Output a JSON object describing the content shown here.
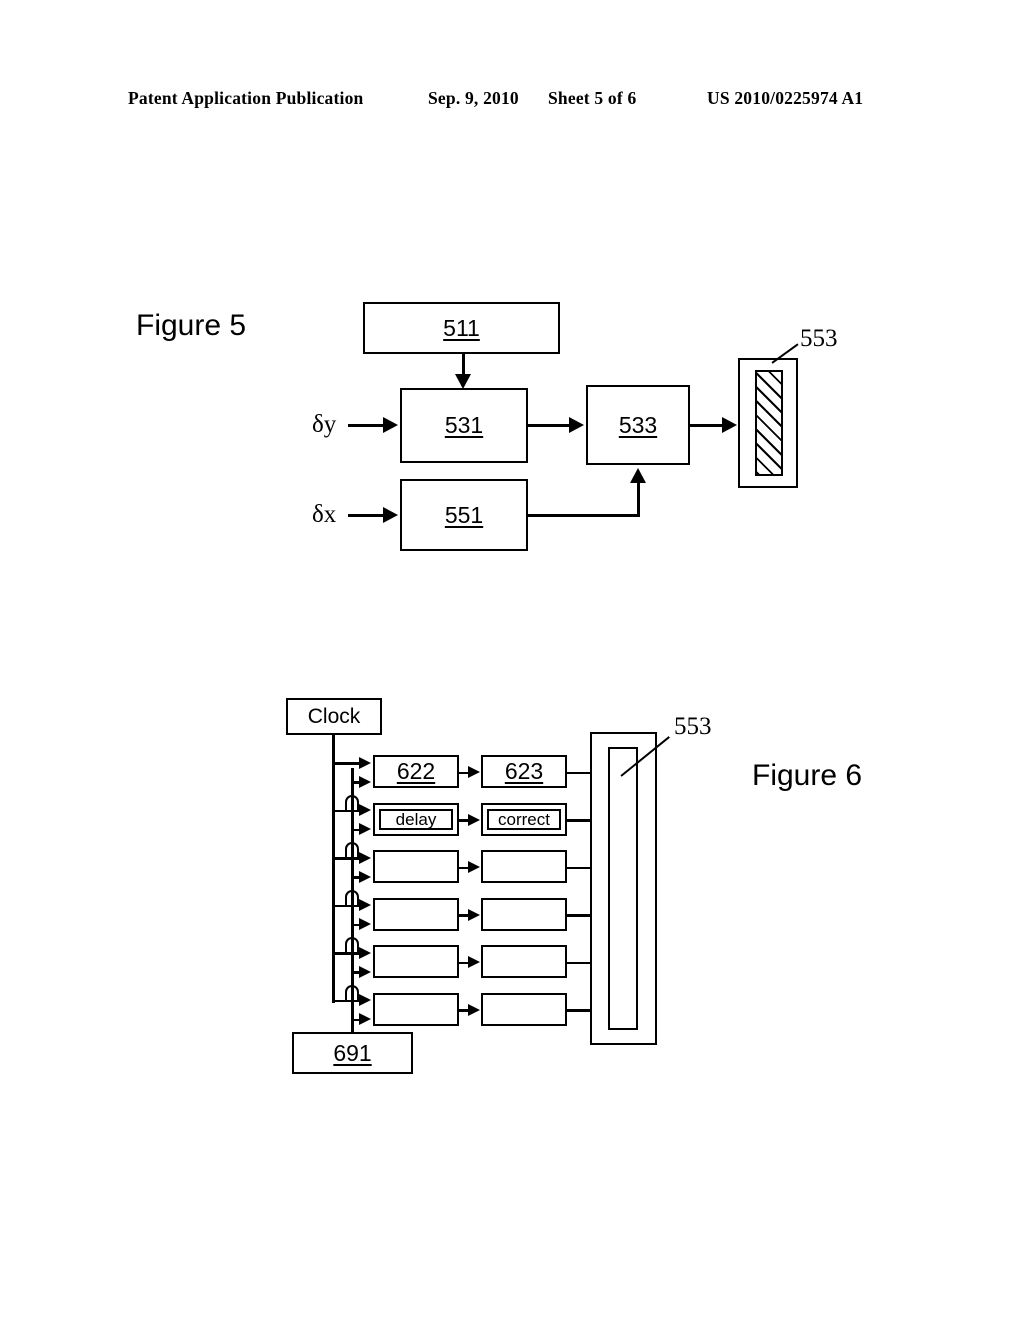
{
  "header": {
    "title": "Patent Application Publication",
    "date": "Sep. 9, 2010",
    "sheet": "Sheet 5 of 6",
    "number": "US 2010/0225974 A1"
  },
  "figure5": {
    "label": "Figure 5",
    "blocks": {
      "b511": "511",
      "b531": "531",
      "b551": "551",
      "b533": "533"
    },
    "inputs": {
      "dy": "δy",
      "dx": "δx"
    },
    "ref_553": "553"
  },
  "figure6": {
    "label": "Figure 6",
    "clock": "Clock",
    "b691": "691",
    "ref_553": "553",
    "rows": [
      {
        "left": "622",
        "right": "623",
        "left_nested": false,
        "right_nested": false,
        "underline": true
      },
      {
        "left": "delay",
        "right": "correct",
        "left_nested": true,
        "right_nested": true,
        "underline": false
      },
      {
        "left": "",
        "right": "",
        "left_nested": false,
        "right_nested": false,
        "underline": false
      },
      {
        "left": "",
        "right": "",
        "left_nested": false,
        "right_nested": false,
        "underline": false
      },
      {
        "left": "",
        "right": "",
        "left_nested": false,
        "right_nested": false,
        "underline": false
      },
      {
        "left": "",
        "right": "",
        "left_nested": false,
        "right_nested": false,
        "underline": false
      }
    ]
  },
  "colors": {
    "ink": "#000000",
    "paper": "#ffffff"
  }
}
